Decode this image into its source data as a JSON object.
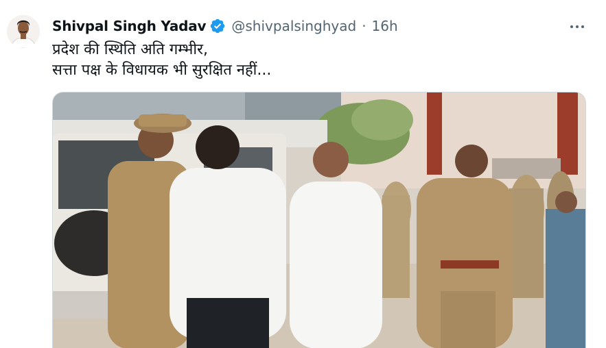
{
  "tweet": {
    "author_name": "Shivpal Singh Yadav",
    "handle": "@shivpalsinghyad",
    "separator": "·",
    "time": "16h",
    "text_lines": [
      "प्रदेश की स्थिति अति गम्भीर,",
      "सत्ता पक्ष के विधायक भी सुरक्षित नहीं..."
    ]
  },
  "icons": {
    "verified": "verified-badge-icon",
    "more": "more-options-icon"
  },
  "colors": {
    "verified": "#1d9bf0",
    "secondary_text": "#536471",
    "primary_text": "#0f1419",
    "border": "#cfd9de"
  }
}
